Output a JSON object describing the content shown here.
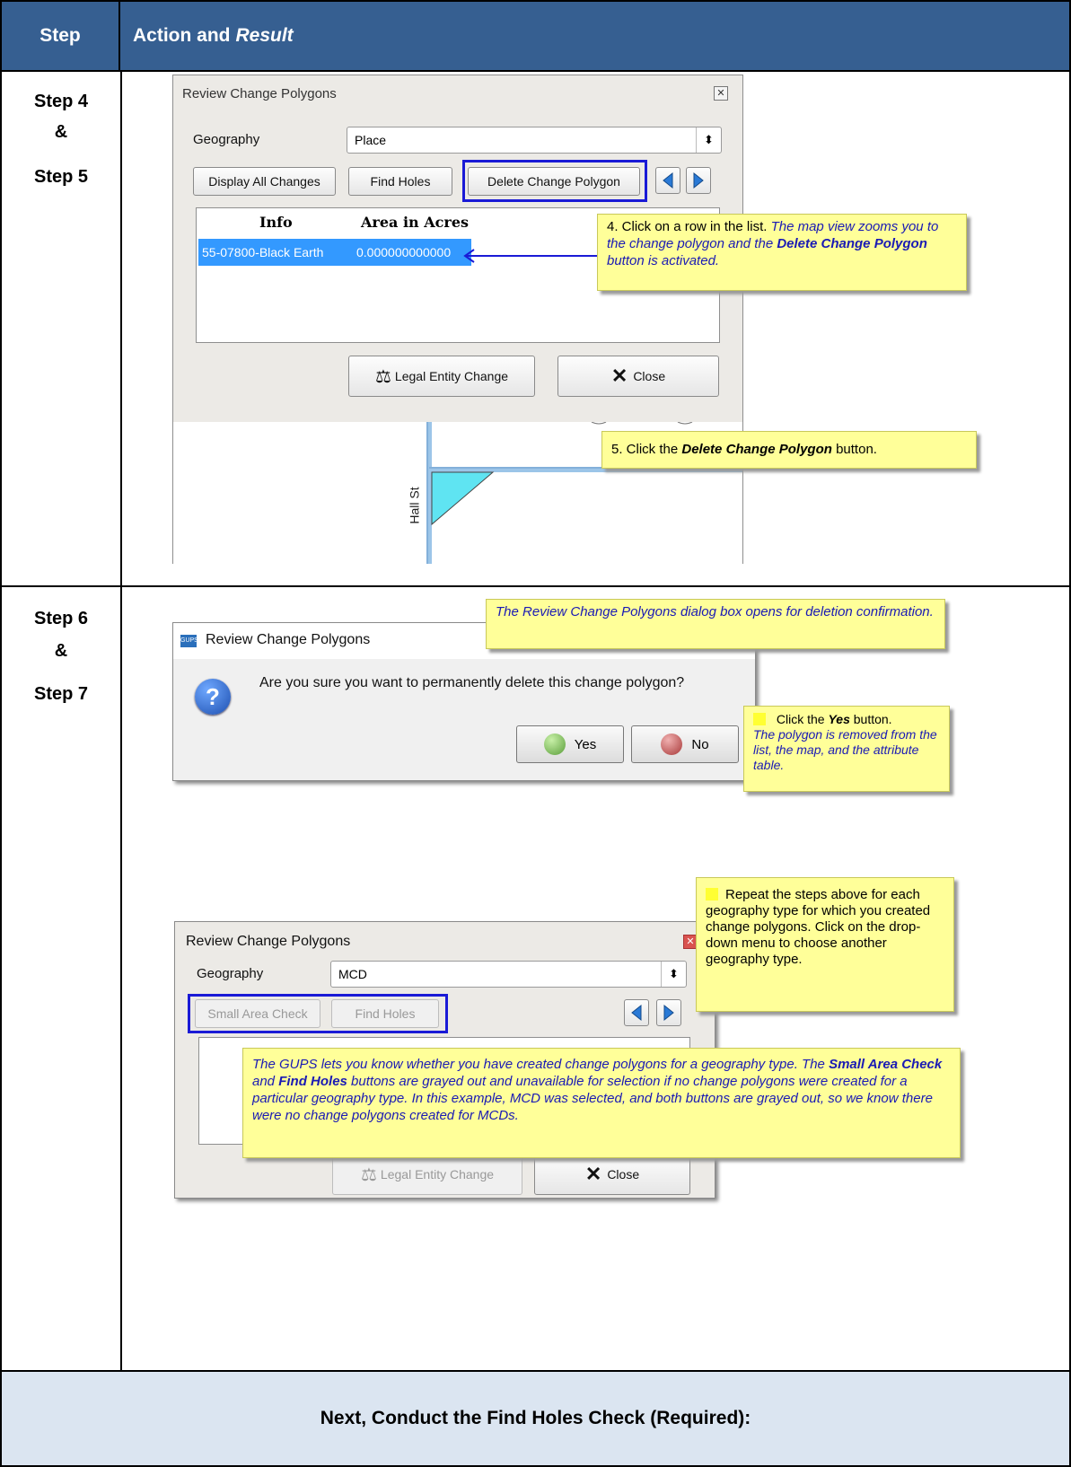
{
  "header": {
    "step": "Step",
    "action": "Action and",
    "result": "Result"
  },
  "rows": [
    {
      "label1": "Step 4",
      "label2": "&",
      "label3": "Step 5"
    },
    {
      "label1": "Step 6",
      "label2": "&",
      "label3": "Step 7"
    }
  ],
  "footer": {
    "text": "Next, Conduct the Find Holes Check (Required):"
  },
  "dialog1": {
    "title": "Review Change Polygons",
    "geography_label": "Geography",
    "geography_value": "Place",
    "btn_display_all": "Display All Changes",
    "btn_find_holes": "Find Holes",
    "btn_delete": "Delete Change Polygon",
    "col_info": "Info",
    "col_area": "Area in Acres",
    "row_info": "55-07800-Black Earth",
    "row_area": "0.000000000000",
    "btn_legal": "Legal Entity Change",
    "btn_close": "Close",
    "map_street": "Hall St"
  },
  "callout4": {
    "prefix": "4. Click on a row in the list.",
    "result1": "The map view zooms you to the change polygon and the",
    "bold": "Delete Change Polygon",
    "result2": "button is activated."
  },
  "callout5": {
    "prefix": "5. Click the",
    "bold": "Delete Change Polygon",
    "suffix": "button."
  },
  "callout6": {
    "text": "The Review Change Polygons dialog box opens for deletion confirmation."
  },
  "dialog2": {
    "title": "Review Change Polygons",
    "app_icon": "GUPS",
    "question": "Are you sure you want to permanently delete this change polygon?",
    "btn_yes": "Yes",
    "btn_no": "No"
  },
  "callout7": {
    "prefix": "Click the",
    "bold": "Yes",
    "suffix": "button.",
    "result": "The polygon is removed from the list, the map, and the attribute table."
  },
  "dialog3": {
    "title": "Review Change Polygons",
    "geography_label": "Geography",
    "geography_value": "MCD",
    "btn_small_area": "Small Area Check",
    "btn_find_holes": "Find Holes",
    "btn_legal": "Legal Entity Change",
    "btn_close": "Close"
  },
  "callout_repeat": {
    "text": "Repeat the steps above for each geography type for which you created change polygons. Click on the drop-down menu to choose another geography type."
  },
  "callout_gups": {
    "t1": "The GUPS lets you know whether you have created change polygons for a geography type. The",
    "b1": "Small Area Check",
    "t2": "and",
    "b2": "Find Holes",
    "t3": "buttons are grayed out and unavailable for selection if no change polygons were created for a particular  geography type.  In this example, MCD was selected, and both buttons are grayed out, so we know there were no change polygons created for MCDs."
  },
  "colors": {
    "header_bg": "#365f91",
    "footer_bg": "#dbe5f1",
    "callout_bg": "#ffff99",
    "highlight_border": "#1a1ad6",
    "selection": "#3399ff"
  }
}
